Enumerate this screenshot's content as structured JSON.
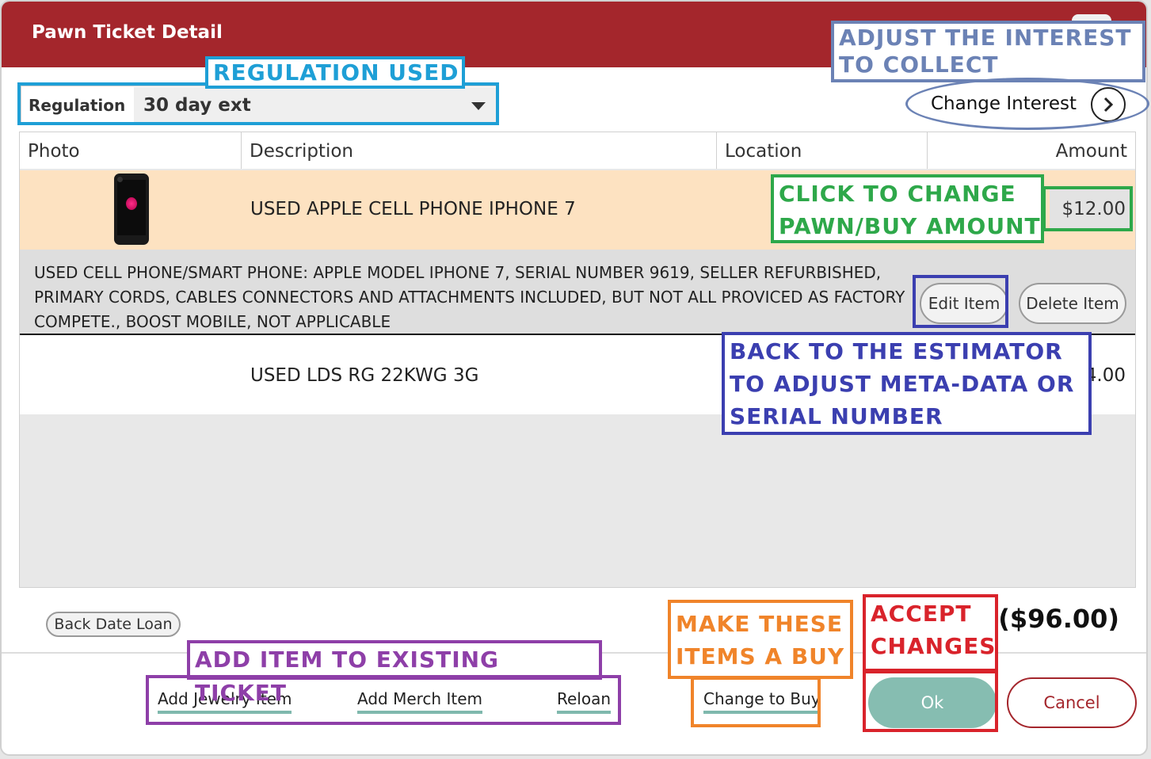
{
  "window": {
    "title": "Pawn Ticket Detail"
  },
  "regulation": {
    "label": "Regulation",
    "value": "30 day ext"
  },
  "change_interest": {
    "label": "Change Interest"
  },
  "table": {
    "headers": [
      "Photo",
      "Description",
      "Location",
      "Amount"
    ],
    "rows": [
      {
        "description": "USED APPLE CELL PHONE IPHONE 7",
        "amount": "$12.00",
        "details": "USED CELL PHONE/SMART PHONE: APPLE MODEL IPHONE 7, SERIAL NUMBER 9619, SELLER REFURBISHED, PRIMARY CORDS, CABLES CONNECTORS AND ATTACHMENTS INCLUDED, BUT NOT ALL PROVICED AS FACTORY COMPETE., BOOST MOBILE, NOT APPLICABLE",
        "edit_label": "Edit Item",
        "delete_label": "Delete Item"
      },
      {
        "description": "USED LDS RG 22KWG 3G",
        "amount": "4.00"
      }
    ]
  },
  "footer": {
    "back_date_label": "Back Date Loan",
    "total": "($96.00)",
    "add_jewelry_label": "Add Jewelry Item",
    "add_merch_label": "Add Merch Item",
    "reload_label": "Reloan",
    "change_to_buy_label": "Change to Buy",
    "ok_label": "Ok",
    "cancel_label": "Cancel"
  },
  "annotations": {
    "regulation_used": "REGULATION USED",
    "adjust_interest_1": "ADJUST THE INTEREST",
    "adjust_interest_2": "TO COLLECT",
    "change_amount_1": "CLICK TO CHANGE",
    "change_amount_2": "PAWN/BUY AMOUNT",
    "estimator_1": "BACK TO THE ESTIMATOR",
    "estimator_2": "TO ADJUST META-DATA OR",
    "estimator_3": "SERIAL NUMBER",
    "add_item": "ADD ITEM TO EXISTING TICKET",
    "make_buy_1": "MAKE THESE",
    "make_buy_2": "ITEMS A BUY",
    "accept_1": "ACCEPT",
    "accept_2": "CHANGES"
  },
  "colors": {
    "titlebar": "#a4262c",
    "selected_row": "#fde2c1",
    "ok_button": "#86bdb1",
    "link_underline": "#7fb8ad",
    "ann_blue_light": "#1e9fd6",
    "ann_slate": "#6b82b5",
    "ann_green": "#2ea84a",
    "ann_indigo": "#3b3fb0",
    "ann_purple": "#8e3fa8",
    "ann_orange": "#f0842a",
    "ann_red": "#d9232b"
  }
}
